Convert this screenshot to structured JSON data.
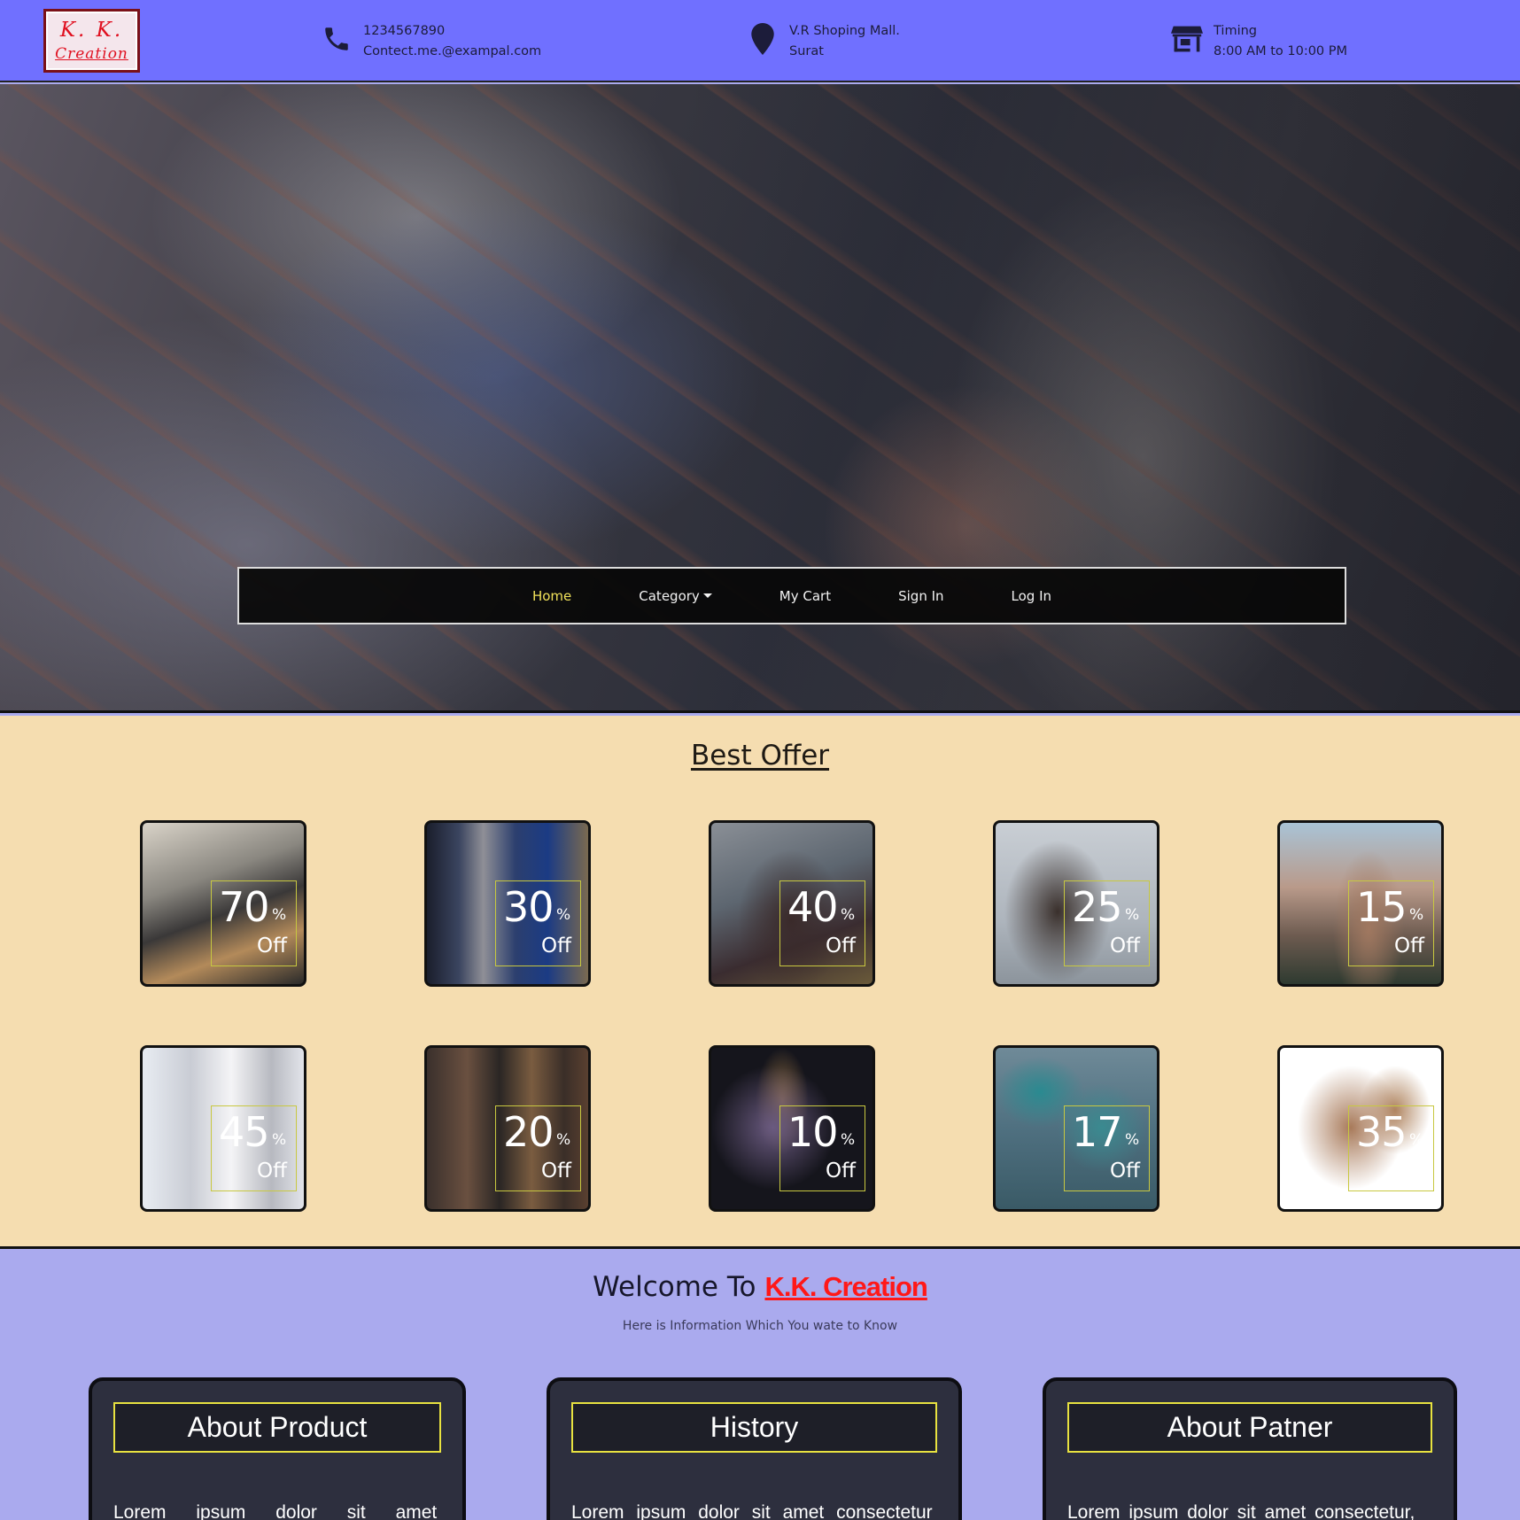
{
  "header": {
    "logo_line1": "K. K.",
    "logo_line2": "Creation",
    "phone": "1234567890",
    "email": "Contect.me.@exampal.com",
    "location_line1": "V.R Shoping Mall.",
    "location_line2": "Surat",
    "timing_label": "Timing",
    "timing_hours": "8:00 AM to 10:00 PM",
    "icons": [
      "phone-icon",
      "map-pin-icon",
      "store-icon"
    ]
  },
  "nav": {
    "items": [
      {
        "label": "Home",
        "active": true
      },
      {
        "label": "Category",
        "dropdown": true
      },
      {
        "label": "My Cart"
      },
      {
        "label": "Sign In"
      },
      {
        "label": "Log In"
      }
    ]
  },
  "offers": {
    "title": "Best Offer",
    "off_label": "Off",
    "pct_symbol": "%",
    "items": [
      {
        "value": "70",
        "image": "iron-and-clothes"
      },
      {
        "value": "30",
        "image": "shirts-on-rack"
      },
      {
        "value": "40",
        "image": "man-with-hat"
      },
      {
        "value": "25",
        "image": "woman-in-jacket"
      },
      {
        "value": "15",
        "image": "woman-in-coat-city"
      },
      {
        "value": "45",
        "image": "wedding-dresses"
      },
      {
        "value": "20",
        "image": "jewellery-necklaces"
      },
      {
        "value": "10",
        "image": "brooch-accessory"
      },
      {
        "value": "17",
        "image": "sneakers"
      },
      {
        "value": "35",
        "image": "heels"
      }
    ]
  },
  "welcome": {
    "prefix": "Welcome To",
    "brand": "K.K. Creation",
    "subtitle": "Here is Information Which You wate to Know",
    "boxes": [
      {
        "title": "About Product",
        "text": "Lorem ipsum dolor sit amet"
      },
      {
        "title": "History",
        "text": "Lorem ipsum dolor sit amet consectetur"
      },
      {
        "title": "About Patner",
        "text": "Lorem ipsum dolor sit amet consectetur,"
      }
    ]
  },
  "colors": {
    "topbar": "#7070ff",
    "offers_bg": "#f5ddb0",
    "welcome_bg": "#aaaaee",
    "nav_active": "#f1e25a",
    "brand_red": "#ff1818"
  }
}
